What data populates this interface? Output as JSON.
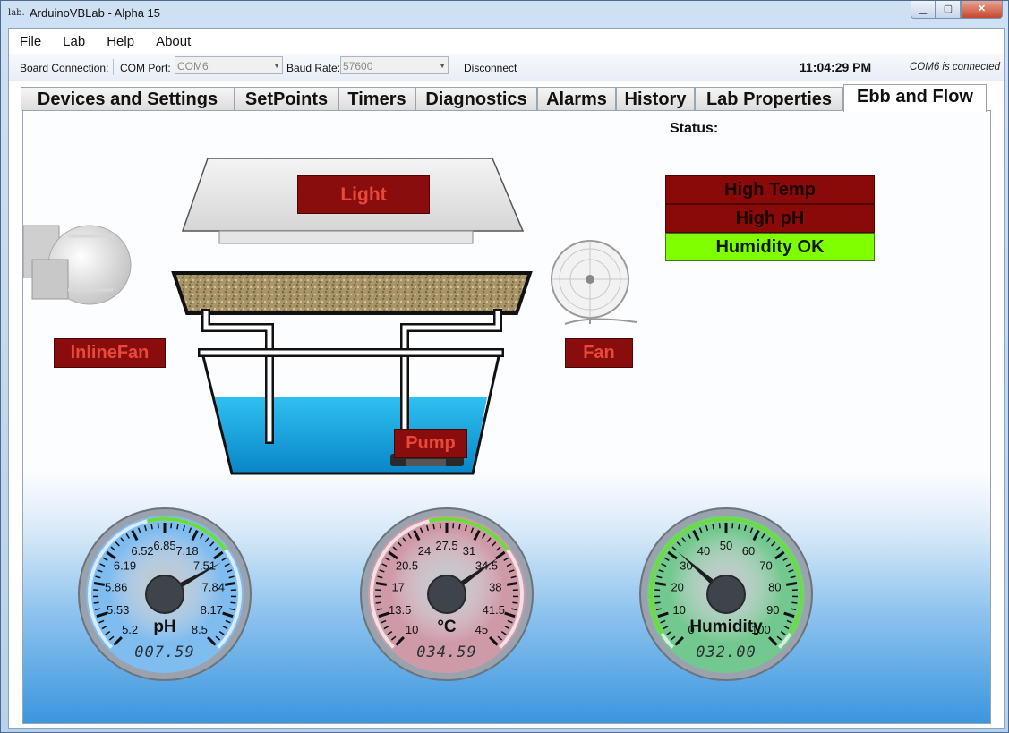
{
  "window": {
    "title": "ArduinoVBLab - Alpha 15",
    "icon_text": "lab.",
    "controls": [
      "minimize-icon",
      "maximize-icon",
      "close-icon"
    ]
  },
  "menu": [
    "File",
    "Lab",
    "Help",
    "About"
  ],
  "toolbar": {
    "board_connection_label": "Board Connection:",
    "com_port_label": "COM Port:",
    "com_port_value": "COM6",
    "baud_rate_label": "Baud Rate:",
    "baud_rate_value": "57600",
    "disconnect_label": "Disconnect",
    "clock": "11:04:29 PM",
    "connection_status": "COM6 is connected"
  },
  "tabs": [
    "Devices and Settings",
    "SetPoints",
    "Timers",
    "Diagnostics",
    "Alarms",
    "History",
    "Lab Properties",
    "Ebb and Flow"
  ],
  "active_tab": "Ebb and Flow",
  "devices": {
    "light": "Light",
    "inline_fan": "InlineFan",
    "fan": "Fan",
    "pump": "Pump"
  },
  "status": {
    "title": "Status:",
    "items": [
      {
        "label": "High Temp",
        "state": "alarm"
      },
      {
        "label": "High pH",
        "state": "alarm"
      },
      {
        "label": "Humidity OK",
        "state": "ok"
      }
    ]
  },
  "gauges": [
    {
      "id": "ph",
      "label": "pH",
      "readout": "007.59",
      "value": 7.59,
      "min": 5.2,
      "max": 8.5,
      "ticks": [
        "5.2",
        "5.53",
        "5.86",
        "6.19",
        "6.52",
        "6.85",
        "7.18",
        "7.51",
        "7.84",
        "8.17",
        "8.5"
      ],
      "face_color": "#7fbcf0"
    },
    {
      "id": "temp",
      "label": "°C",
      "readout": "034.59",
      "value": 34.59,
      "min": 10,
      "max": 45,
      "ticks": [
        "10",
        "13.5",
        "17",
        "20.5",
        "24",
        "27.5",
        "31",
        "34.5",
        "38",
        "41.5",
        "45"
      ],
      "face_color": "#cf9aa8"
    },
    {
      "id": "humidity",
      "label": "Humidity",
      "readout": "032.00",
      "value": 32.0,
      "min": 0,
      "max": 100,
      "ticks": [
        "0",
        "10",
        "20",
        "30",
        "40",
        "50",
        "60",
        "70",
        "80",
        "90",
        "100"
      ],
      "face_color": "#73c88f"
    }
  ],
  "colors": {
    "alarm_bg": "#8a0a0a",
    "alarm_text": "#1a0000",
    "ok_bg": "#7fff00",
    "ok_text": "#0a1a00",
    "device_off_text": "#e84a3a"
  }
}
